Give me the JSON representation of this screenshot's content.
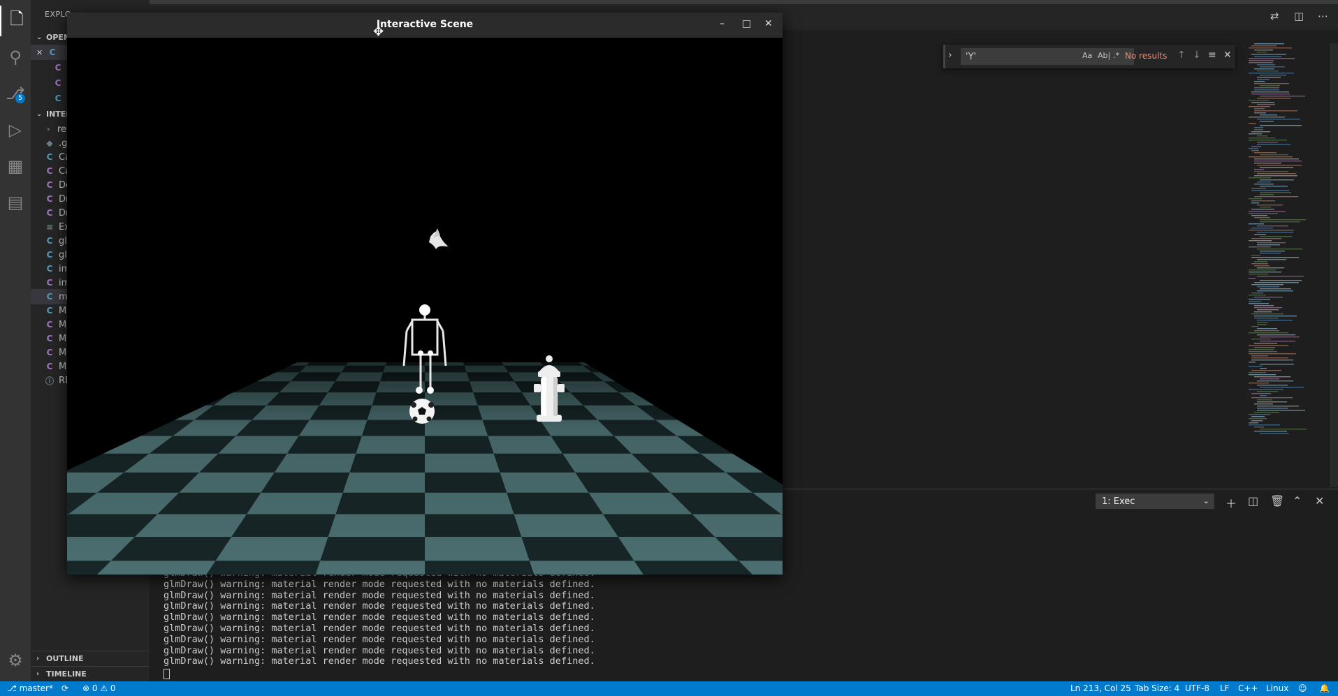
{
  "sidebar": {
    "title": "EXPLO",
    "open_editors_label": "OPEN",
    "project_label": "INTER",
    "open_items": [
      {
        "icon": "C⁢",
        "label": ""
      },
      {
        "icon": "C",
        "label": ""
      },
      {
        "icon": "C",
        "label": ""
      },
      {
        "icon": "C⁢",
        "label": ""
      }
    ],
    "files": [
      {
        "icon": "›",
        "label": "res"
      },
      {
        "icon": "◆",
        "label": ".git"
      },
      {
        "icon": "C",
        "label": "Ca"
      },
      {
        "icon": "C",
        "label": "Ca"
      },
      {
        "icon": "C",
        "label": "De"
      },
      {
        "icon": "C",
        "label": "Dr"
      },
      {
        "icon": "C",
        "label": "Dr"
      },
      {
        "icon": "≡",
        "label": "Exe"
      },
      {
        "icon": "C",
        "label": "glm"
      },
      {
        "icon": "C",
        "label": "glm"
      },
      {
        "icon": "C",
        "label": "ima"
      },
      {
        "icon": "C",
        "label": "ima"
      },
      {
        "icon": "C",
        "label": "ma"
      },
      {
        "icon": "C",
        "label": "Ma"
      },
      {
        "icon": "C",
        "label": "Ma"
      },
      {
        "icon": "C",
        "label": "Ma"
      },
      {
        "icon": "C",
        "label": "Ma"
      },
      {
        "icon": "C",
        "label": "Ma"
      },
      {
        "icon": "ⓘ",
        "label": "REA"
      }
    ],
    "outline_label": "OUTLINE",
    "timeline_label": "TIMELINE"
  },
  "activity": {
    "scm_badge": "5"
  },
  "find": {
    "value": "'Y'",
    "case_label": "Aa",
    "word_label": "Ab|",
    "regex_label": ".*",
    "result": "No results"
  },
  "panel": {
    "terminal_name": "1: Exec",
    "lines": [
      "glmDraw() warning: material render mode requested with no materials defined.",
      "glmDraw() warning: material render mode requested with no materials defined.",
      "glmDraw() warning: material render mode requested with no materials defined.",
      "glmDraw() warning: material render mode requested with no materials defined.",
      "glmDraw() warning: material render mode requested with no materials defined.",
      "glmDraw() warning: material render mode requested with no materials defined.",
      "glmDraw() warning: material render mode requested with no materials defined.",
      "glmDraw() warning: material render mode requested with no materials defined.",
      "glmDraw() warning: material render mode requested with no materials defined."
    ]
  },
  "scene_window": {
    "title": "Interactive Scene"
  },
  "statusbar": {
    "branch": "master*",
    "problems": "⊗ 0 ⚠ 0",
    "position": "Ln 213, Col 25",
    "tab_size": "Tab Size: 4",
    "encoding": "UTF-8",
    "eol": "LF",
    "language": "C++",
    "os": "Linux"
  },
  "colors": {
    "accent": "#007acc",
    "sidebar": "#252526",
    "editor": "#1e1e1e",
    "floor_light": "#5f8a8c",
    "floor_dark": "#1a2a2c"
  }
}
